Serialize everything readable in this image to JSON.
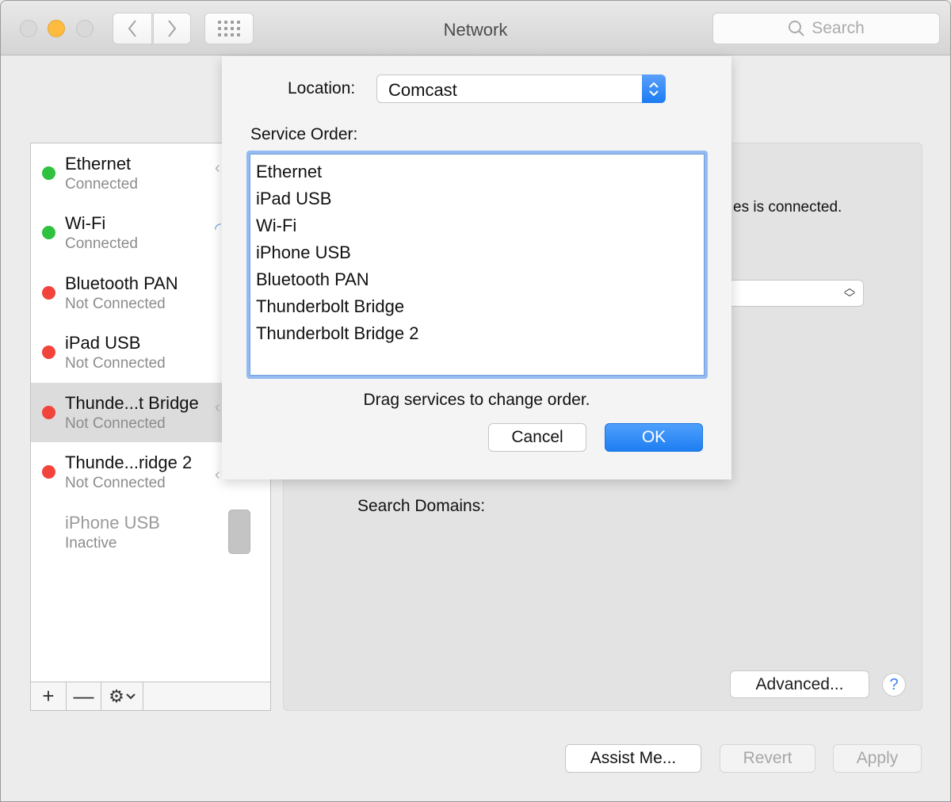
{
  "window": {
    "title": "Network",
    "search_placeholder": "Search"
  },
  "colors": {
    "connected": "#2fc13f",
    "not_connected": "#f2443c",
    "accent": "#1d7ef2",
    "minimize": "#fdbc40"
  },
  "sidebar": {
    "services": [
      {
        "name": "Ethernet",
        "status": "Connected",
        "state": "connected",
        "icon": "ethernet-icon"
      },
      {
        "name": "Wi-Fi",
        "status": "Connected",
        "state": "connected",
        "icon": "wifi-icon"
      },
      {
        "name": "Bluetooth PAN",
        "status": "Not Connected",
        "state": "not_connected",
        "icon": "bluetooth-icon"
      },
      {
        "name": "iPad USB",
        "status": "Not Connected",
        "state": "not_connected",
        "icon": "ipad-icon"
      },
      {
        "name": "Thunde...t Bridge",
        "status": "Not Connected",
        "state": "not_connected",
        "icon": "thunderbolt-icon",
        "selected": true
      },
      {
        "name": "Thunde...ridge 2",
        "status": "Not Connected",
        "state": "not_connected",
        "icon": "thunderbolt-icon"
      },
      {
        "name": "iPhone USB",
        "status": "Inactive",
        "state": "inactive",
        "icon": "iphone-icon"
      }
    ],
    "toolbar": {
      "add": "+",
      "remove": "—",
      "gear": "⚙"
    }
  },
  "panel": {
    "status_text_fragment": "es is connected.",
    "search_domains_label": "Search Domains:",
    "advanced_label": "Advanced...",
    "help_label": "?"
  },
  "footer": {
    "assist_label": "Assist Me...",
    "revert_label": "Revert",
    "apply_label": "Apply"
  },
  "sheet": {
    "location_label": "Location:",
    "location_value": "Comcast",
    "service_order_label": "Service Order:",
    "service_order": [
      "Ethernet",
      "iPad USB",
      "Wi-Fi",
      "iPhone USB",
      "Bluetooth PAN",
      "Thunderbolt Bridge",
      "Thunderbolt Bridge 2"
    ],
    "hint": "Drag services to change order.",
    "cancel_label": "Cancel",
    "ok_label": "OK"
  }
}
